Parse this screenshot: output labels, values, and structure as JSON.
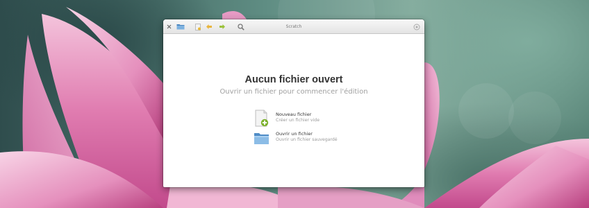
{
  "window": {
    "title": "Scratch"
  },
  "toolbar": {
    "close_icon": "close-icon",
    "open_icon": "folder-icon",
    "new_icon": "new-document-icon",
    "revert_icon": "revert-icon",
    "save_icon": "save-icon",
    "search_icon": "search-icon",
    "menu_icon": "app-menu-icon"
  },
  "welcome": {
    "title": "Aucun fichier ouvert",
    "subtitle": "Ouvrir un fichier pour commencer l'édition",
    "actions": [
      {
        "icon": "new-document-icon",
        "title": "Nouveau fichier",
        "description": "Créer un fichier vide"
      },
      {
        "icon": "folder-icon",
        "title": "Ouvrir un fichier",
        "description": "Ouvrir un fichier sauvegardé"
      }
    ]
  },
  "colors": {
    "accent_green": "#7cb02c",
    "folder_blue": "#6aa0d0",
    "window_bg": "#ffffff"
  }
}
